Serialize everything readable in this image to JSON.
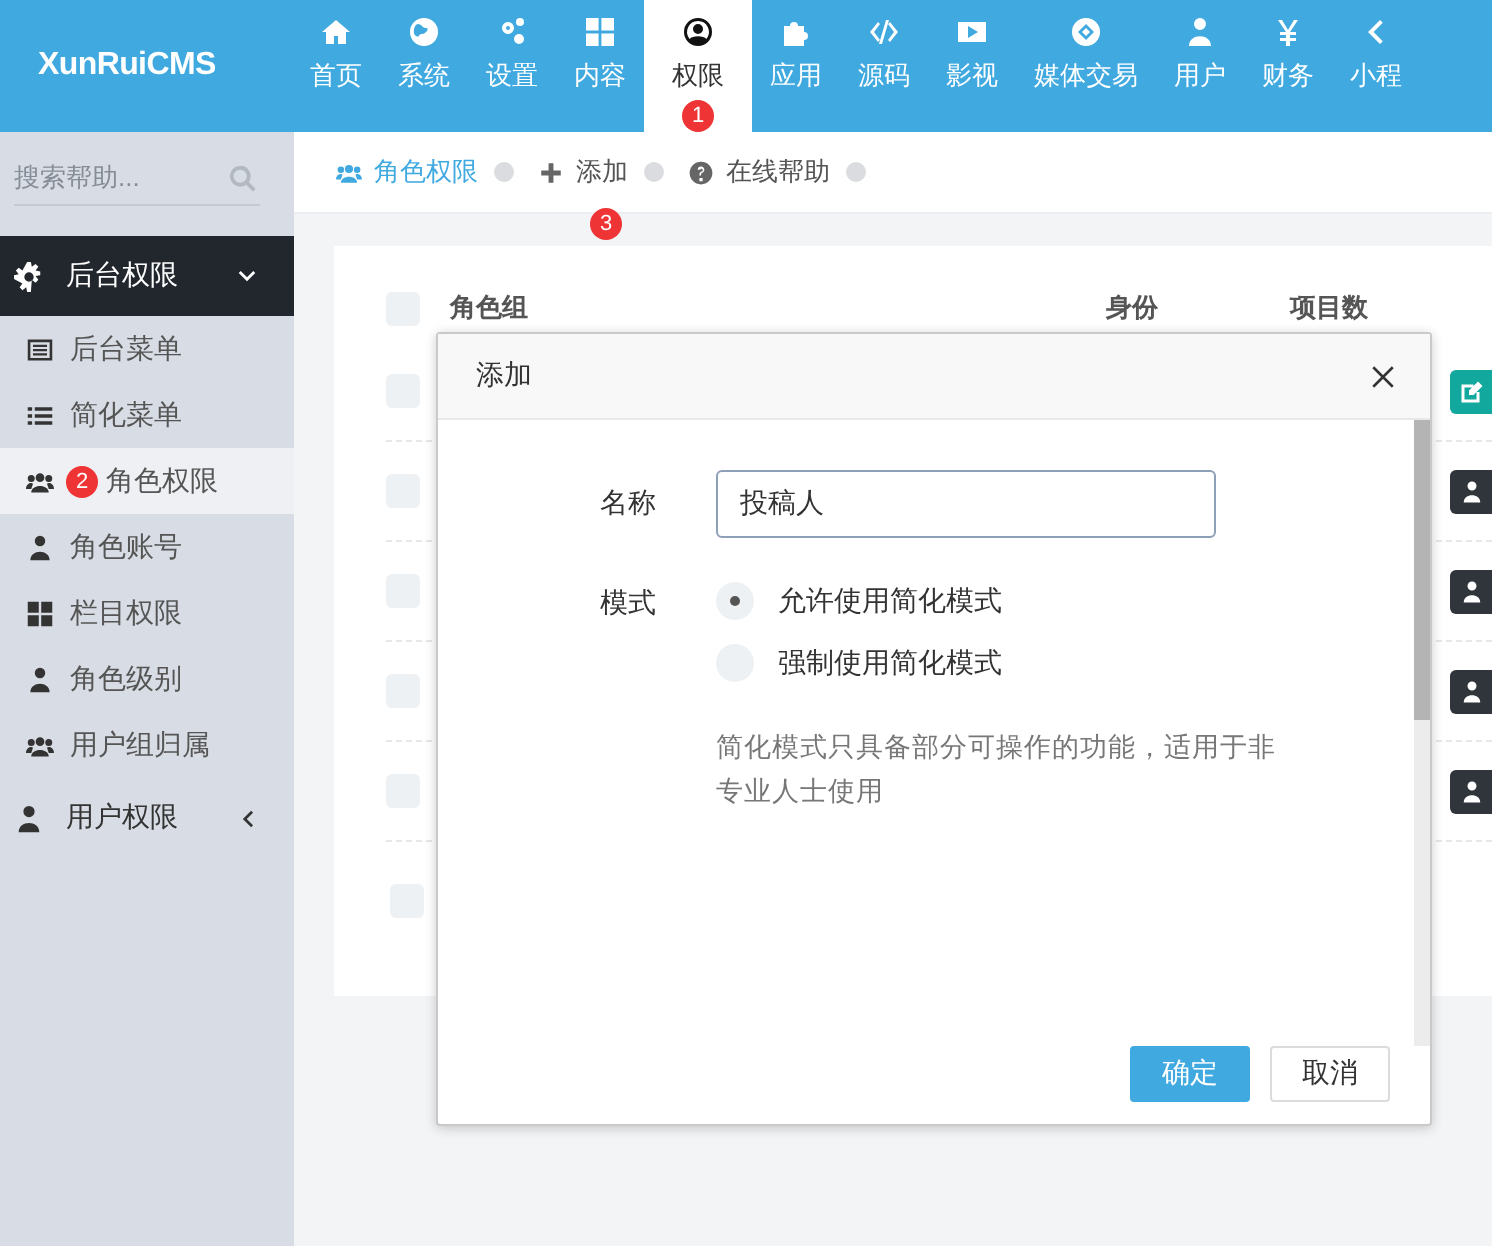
{
  "header": {
    "logo": "XunRuiCMS",
    "nav": [
      {
        "label": "首页",
        "selected": false
      },
      {
        "label": "系统",
        "selected": false
      },
      {
        "label": "设置",
        "selected": false
      },
      {
        "label": "内容",
        "selected": false
      },
      {
        "label": "权限",
        "selected": true,
        "badge": "1"
      },
      {
        "label": "应用",
        "selected": false
      },
      {
        "label": "源码",
        "selected": false
      },
      {
        "label": "影视",
        "selected": false
      },
      {
        "label": "媒体交易",
        "selected": false
      },
      {
        "label": "用户",
        "selected": false
      },
      {
        "label": "财务",
        "selected": false
      },
      {
        "label": "小程",
        "selected": false
      }
    ]
  },
  "sidebar": {
    "search": {
      "placeholder": "搜索帮助..."
    },
    "groups": [
      {
        "label": "后台权限",
        "expanded": true,
        "items": [
          {
            "label": "后台菜单",
            "selected": false
          },
          {
            "label": "简化菜单",
            "selected": false
          },
          {
            "label": "角色权限",
            "selected": true,
            "badge": "2"
          },
          {
            "label": "角色账号",
            "selected": false
          },
          {
            "label": "栏目权限",
            "selected": false
          },
          {
            "label": "角色级别",
            "selected": false
          },
          {
            "label": "用户组归属",
            "selected": false
          }
        ]
      },
      {
        "label": "用户权限",
        "expanded": false
      }
    ]
  },
  "breadcrumb": [
    {
      "label": "角色权限",
      "selected": true
    },
    {
      "label": "添加",
      "selected": false,
      "badge": "3"
    },
    {
      "label": "在线帮助",
      "selected": false
    }
  ],
  "table": {
    "columns": [
      "角色组",
      "身份",
      "项目数"
    ],
    "header_checked": false,
    "rows": [
      {
        "checked": false,
        "kind": "edit"
      },
      {
        "checked": false,
        "kind": "user"
      },
      {
        "checked": false,
        "kind": "user"
      },
      {
        "checked": false,
        "kind": "user"
      },
      {
        "checked": false,
        "kind": "user"
      }
    ],
    "footer_checked": false
  },
  "dialog": {
    "title": "添加",
    "name_label": "名称",
    "name_value": "投稿人",
    "mode_label": "模式",
    "options": [
      {
        "label": "允许使用简化模式",
        "selected": true
      },
      {
        "label": "强制使用简化模式",
        "selected": false
      }
    ],
    "help": "简化模式只具备部分可操作的功能，适用于非专业人士使用",
    "buttons": [
      {
        "label": "确定",
        "kind": "primary"
      },
      {
        "label": "取消",
        "kind": "default"
      }
    ]
  }
}
